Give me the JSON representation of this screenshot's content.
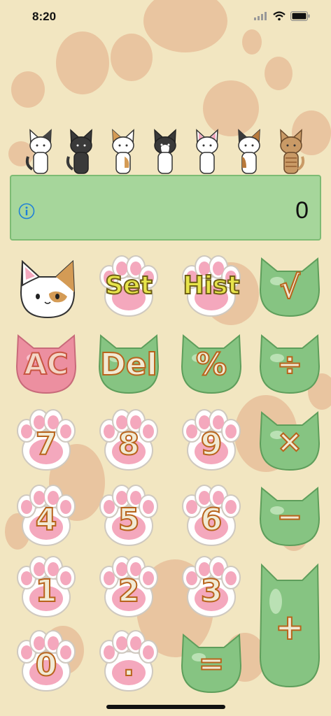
{
  "status": {
    "time": "8:20"
  },
  "display": {
    "value": "0"
  },
  "cats": [
    {
      "name": "white-cat",
      "body": "#ffffff",
      "patch": "#444444"
    },
    {
      "name": "black-cat",
      "body": "#3a3a3a",
      "patch": "#3a3a3a"
    },
    {
      "name": "calico-cat",
      "body": "#ffffff",
      "patch": "#d49b55"
    },
    {
      "name": "tuxedo-cat",
      "body": "#ffffff",
      "patch": "#3a3a3a"
    },
    {
      "name": "white-cat",
      "body": "#ffffff",
      "patch": "#ffffff"
    },
    {
      "name": "tortie-cat",
      "body": "#ffffff",
      "patch": "#b8793a"
    },
    {
      "name": "tabby-cat",
      "body": "#c99a66",
      "patch": "#9f6b3c"
    }
  ],
  "keys": {
    "set": "Set",
    "hist": "Hist",
    "sqrt": "√",
    "ac": "AC",
    "del": "Del",
    "percent": "%",
    "divide": "÷",
    "seven": "7",
    "eight": "8",
    "nine": "9",
    "multiply": "×",
    "four": "4",
    "five": "5",
    "six": "6",
    "minus": "−",
    "one": "1",
    "two": "2",
    "three": "3",
    "plus": "+",
    "zero": "0",
    "dot": ".",
    "equals": "="
  },
  "colors": {
    "background": "#f2e6c1",
    "spots": "#e9c5a0",
    "display": "#a6d69b",
    "green_key": "#86c482",
    "paw_pad": "#f4a8bd",
    "ac_key": "#ec8fa0",
    "yellow_text": "#e7e44a",
    "label_outline": "#b8641c"
  }
}
